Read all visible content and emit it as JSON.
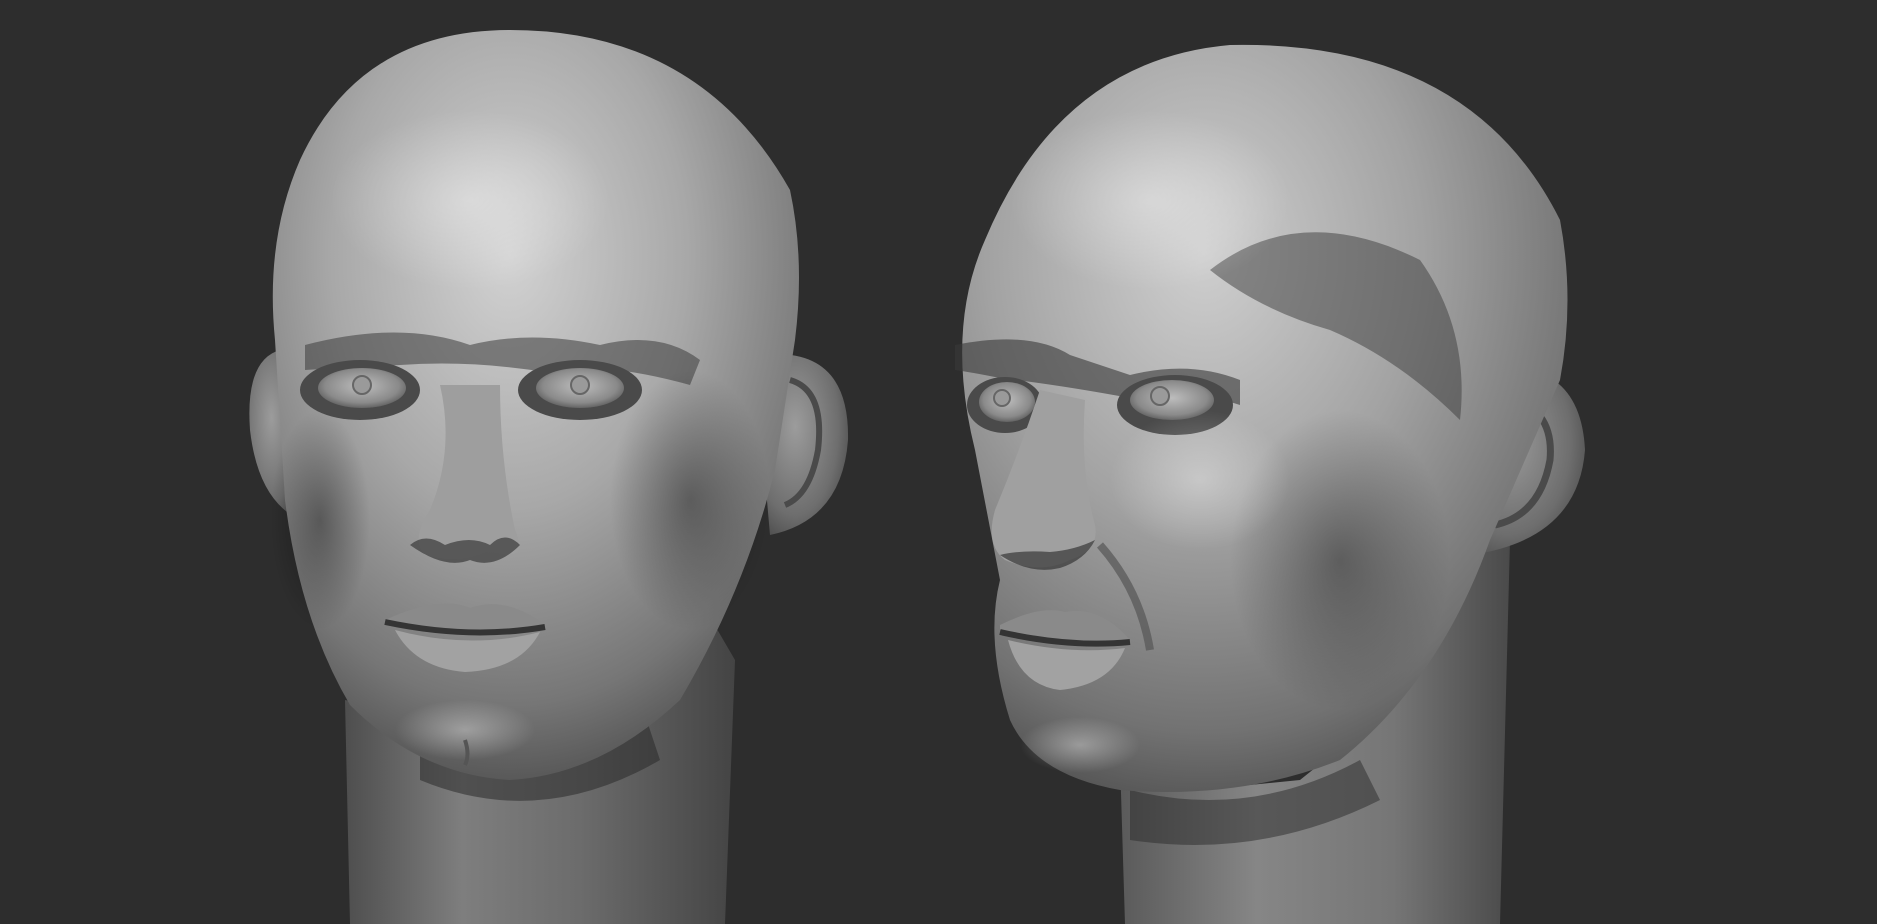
{
  "scene": {
    "background_color": "#2d2d2d",
    "material": "clay-matcap-gray",
    "material_colors": {
      "highlight": "#d8d8d8",
      "mid": "#8e8e8e",
      "shadow": "#3a3a3a",
      "deep_shadow": "#232323"
    },
    "models": [
      {
        "name": "head-sculpt-front-view",
        "view": "front"
      },
      {
        "name": "head-sculpt-three-quarter-view",
        "view": "three-quarter"
      }
    ]
  }
}
